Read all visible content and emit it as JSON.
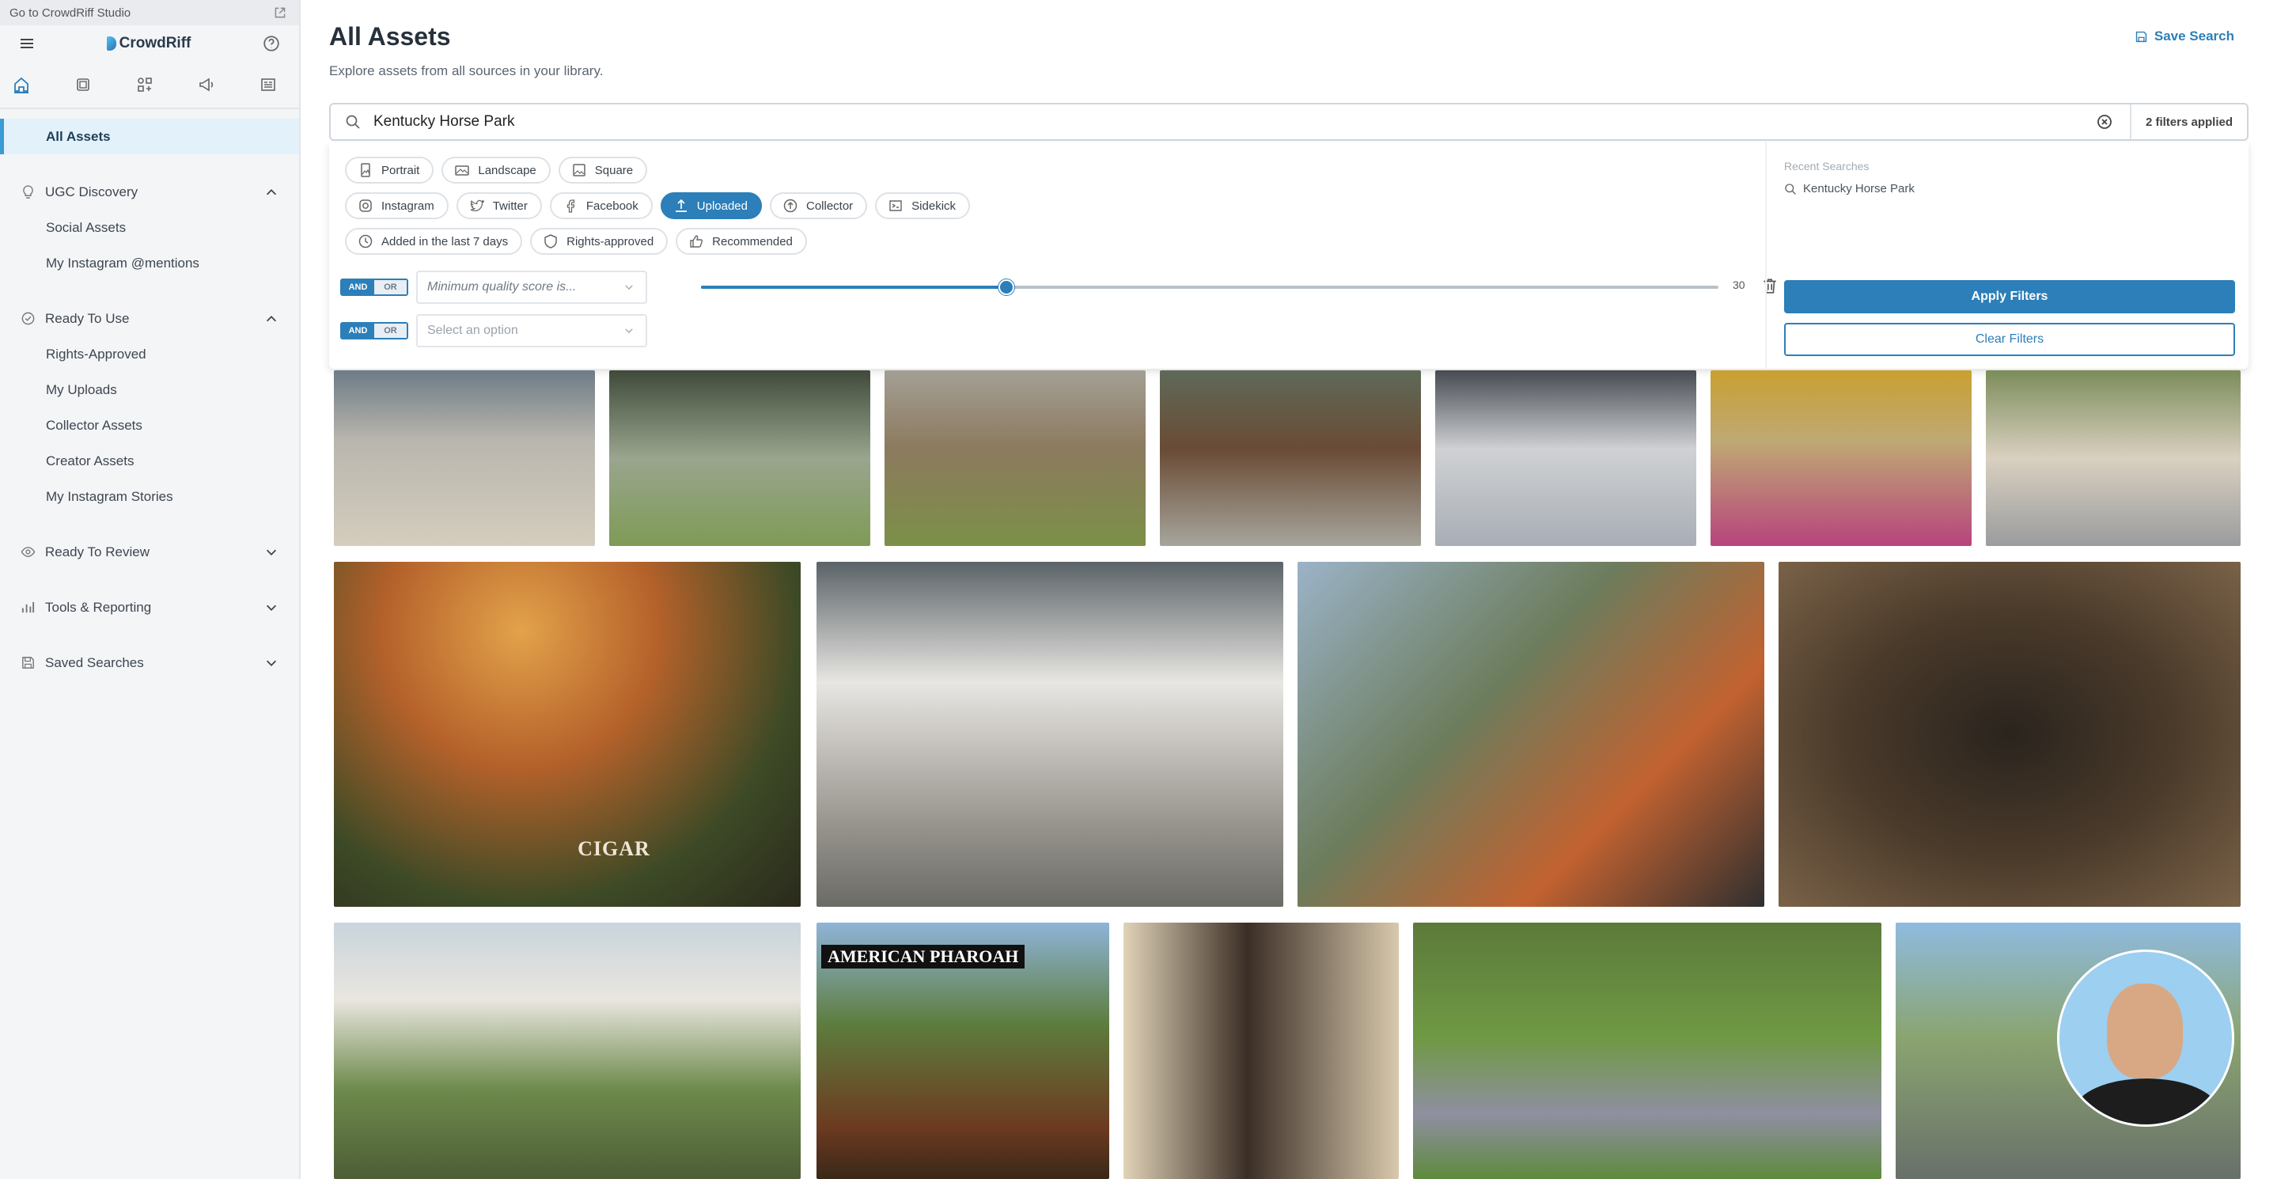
{
  "sidebar": {
    "studio_link": "Go to CrowdRiff Studio",
    "brand": "CrowdRiff",
    "active_item": "All Assets",
    "sections": [
      {
        "label": "UGC Discovery",
        "expanded": true,
        "items": [
          "Social Assets",
          "My Instagram @mentions"
        ]
      },
      {
        "label": "Ready To Use",
        "expanded": true,
        "items": [
          "Rights-Approved",
          "My Uploads",
          "Collector Assets",
          "Creator Assets",
          "My Instagram Stories"
        ]
      },
      {
        "label": "Ready To Review",
        "expanded": false,
        "items": []
      },
      {
        "label": "Tools & Reporting",
        "expanded": false,
        "items": []
      },
      {
        "label": "Saved Searches",
        "expanded": false,
        "items": []
      }
    ]
  },
  "header": {
    "title": "All Assets",
    "subtitle": "Explore assets from all sources in your library.",
    "save_search": "Save Search"
  },
  "search": {
    "value": "Kentucky Horse Park",
    "filters_applied": "2 filters applied"
  },
  "filters": {
    "rows": [
      [
        {
          "label": "Portrait",
          "icon": "portrait-icon"
        },
        {
          "label": "Landscape",
          "icon": "landscape-icon"
        },
        {
          "label": "Square",
          "icon": "square-icon"
        }
      ],
      [
        {
          "label": "Instagram",
          "icon": "instagram-icon"
        },
        {
          "label": "Twitter",
          "icon": "twitter-icon"
        },
        {
          "label": "Facebook",
          "icon": "facebook-icon"
        },
        {
          "label": "Uploaded",
          "icon": "upload-icon",
          "active": true
        },
        {
          "label": "Collector",
          "icon": "collector-icon"
        },
        {
          "label": "Sidekick",
          "icon": "sidekick-icon"
        }
      ],
      [
        {
          "label": "Added in the last 7 days",
          "icon": "clock-icon"
        },
        {
          "label": "Rights-approved",
          "icon": "shield-icon"
        },
        {
          "label": "Recommended",
          "icon": "thumbs-up-icon"
        }
      ]
    ],
    "andor": {
      "and": "AND",
      "or": "OR"
    },
    "condition_1": {
      "field": "Minimum quality score is...",
      "slider_value": 30,
      "slider_min": 0,
      "slider_max": 100,
      "max_label": "30"
    },
    "condition_2": {
      "placeholder": "Select an option"
    },
    "recent_title": "Recent Searches",
    "recent_items": [
      "Kentucky Horse Park"
    ],
    "apply": "Apply Filters",
    "clear": "Clear Filters"
  },
  "grid": {
    "captions": {
      "cigar": "CIGAR",
      "pharoah": "AMERICAN PHAROAH"
    }
  },
  "colors": {
    "accent": "#2c7fb8",
    "sidebar_bg": "#f4f5f7",
    "active_nav": "#e3f2fa"
  }
}
